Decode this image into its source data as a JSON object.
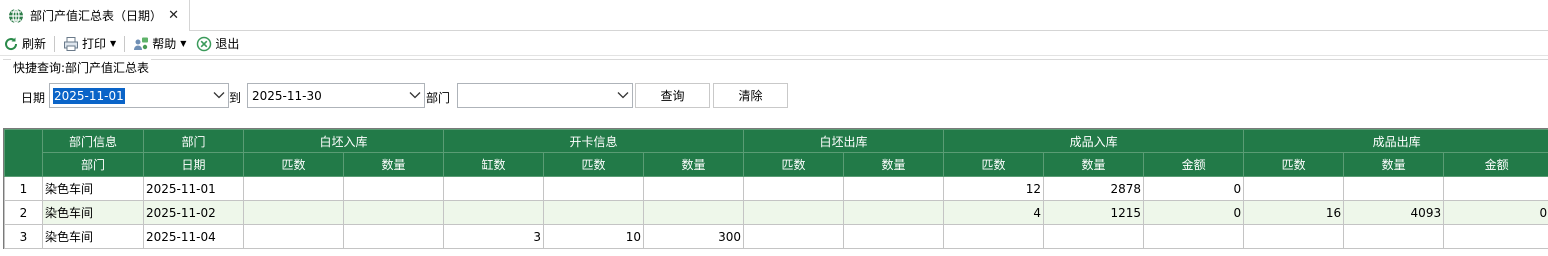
{
  "tab": {
    "title": "部门产值汇总表（日期）",
    "icon": "globe-table-icon",
    "close": "✕"
  },
  "toolbar": {
    "refresh": "刷新",
    "print": "打印",
    "help": "帮助",
    "exit": "退出"
  },
  "query": {
    "legend": "快捷查询:部门产值汇总表",
    "date_label": "日期",
    "date_from": "2025-11-01",
    "to_label": "到",
    "date_to": "2025-11-30",
    "dept_label": "部门",
    "dept_value": "",
    "search_button": "查询",
    "clear_button": "清除"
  },
  "grid": {
    "group_headers": [
      "部门信息",
      "部门",
      "白坯入库",
      "开卡信息",
      "白坯出库",
      "成品入库",
      "成品出库"
    ],
    "column_headers": [
      "部门",
      "日期",
      "匹数",
      "数量",
      "缸数",
      "匹数",
      "数量",
      "匹数",
      "数量",
      "匹数",
      "数量",
      "金额",
      "匹数",
      "数量",
      "金额"
    ],
    "rows": [
      {
        "num": "1",
        "cells": [
          "染色车间",
          "2025-11-01",
          "",
          "",
          "",
          "",
          "",
          "",
          "",
          "12",
          "2878",
          "0",
          "",
          "",
          ""
        ]
      },
      {
        "num": "2",
        "cells": [
          "染色车间",
          "2025-11-02",
          "",
          "",
          "",
          "",
          "",
          "",
          "",
          "4",
          "1215",
          "0",
          "16",
          "4093",
          "0"
        ]
      },
      {
        "num": "3",
        "cells": [
          "染色车间",
          "2025-11-04",
          "",
          "",
          "3",
          "10",
          "300",
          "",
          "",
          "",
          "",
          "",
          "",
          "",
          ""
        ]
      }
    ]
  },
  "colors": {
    "header_green": "#227a48",
    "row_tint": "#eef7ea",
    "selection_blue": "#0a64c8"
  }
}
